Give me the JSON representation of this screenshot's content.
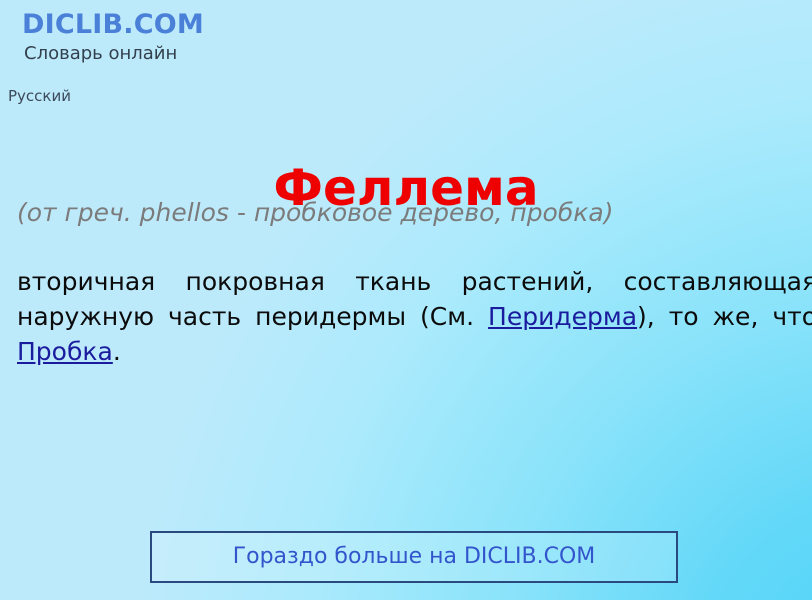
{
  "header": {
    "logo": "DICLIB.COM",
    "tagline": "Словарь онлайн",
    "language": "Русский"
  },
  "entry": {
    "title": "Феллема",
    "etymology": "(от греч. phellos - пробковое дерево, пробка)",
    "definition_part1": "вторичная покровная ткань растений, составляющая наружную часть перидермы (См. ",
    "link1": "Перидерма",
    "definition_part2": "), то же, что ",
    "link2": "Пробка",
    "definition_part3": "."
  },
  "cta": {
    "label": "Гораздо больше на DICLIB.COM"
  },
  "colors": {
    "logo": "#4a80d8",
    "title": "#ee0000",
    "etymology": "#7b7b7b",
    "link": "#1b1b9e",
    "cta_text": "#3355cc",
    "cta_border": "#2a4a7f",
    "background_top": "#bdeafb",
    "background_bottom_right": "#4fd4f7"
  }
}
